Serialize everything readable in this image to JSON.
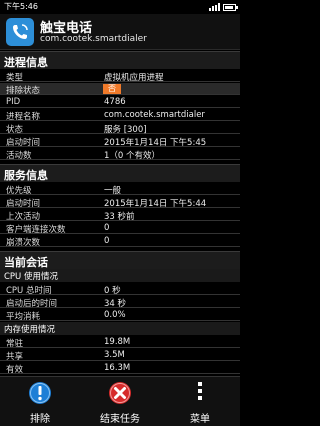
{
  "status_bar": {
    "time": "下午5:46"
  },
  "app": {
    "name": "触宝电话",
    "package": "com.cootek.smartdialer"
  },
  "process_info": {
    "title": "进程信息",
    "rows": [
      {
        "label": "类型",
        "value": "虚拟机应用进程"
      },
      {
        "label": "排除状态",
        "value": "否"
      },
      {
        "label": "PID",
        "value": "4786"
      },
      {
        "label": "进程名称",
        "value": "com.cootek.smartdialer"
      },
      {
        "label": "状态",
        "value": "服务 [300]"
      },
      {
        "label": "启动时间",
        "value": "2015年1月14日 下午5:45"
      },
      {
        "label": "活动数",
        "value": "1（0 个有效）"
      }
    ]
  },
  "service_info": {
    "title": "服务信息",
    "rows": [
      {
        "label": "优先级",
        "value": "一般"
      },
      {
        "label": "启动时间",
        "value": "2015年1月14日 下午5:44"
      },
      {
        "label": "上次活动",
        "value": "33 秒前"
      },
      {
        "label": "客户端连接次数",
        "value": "0"
      },
      {
        "label": "崩溃次数",
        "value": "0"
      }
    ]
  },
  "current_session": {
    "title": "当前会话",
    "cpu_title": "CPU 使用情况",
    "cpu_rows": [
      {
        "label": "CPU 总时间",
        "value": "0 秒"
      },
      {
        "label": "启动后的时间",
        "value": "34 秒"
      },
      {
        "label": "平均消耗",
        "value": "0.0%"
      }
    ],
    "mem_title": "内存使用情况",
    "mem_rows": [
      {
        "label": "常驻",
        "value": "19.8M"
      },
      {
        "label": "共享",
        "value": "3.5M"
      },
      {
        "label": "有效",
        "value": "16.3M"
      }
    ]
  },
  "actions": {
    "exclude": "排除",
    "end_task": "结束任务",
    "menu": "菜单"
  },
  "colors": {
    "exclude_icon": "#1e7fd6",
    "end_task_icon": "#d62b2b",
    "badge": "#f07a2a",
    "app_icon": "#2d8fd8"
  }
}
